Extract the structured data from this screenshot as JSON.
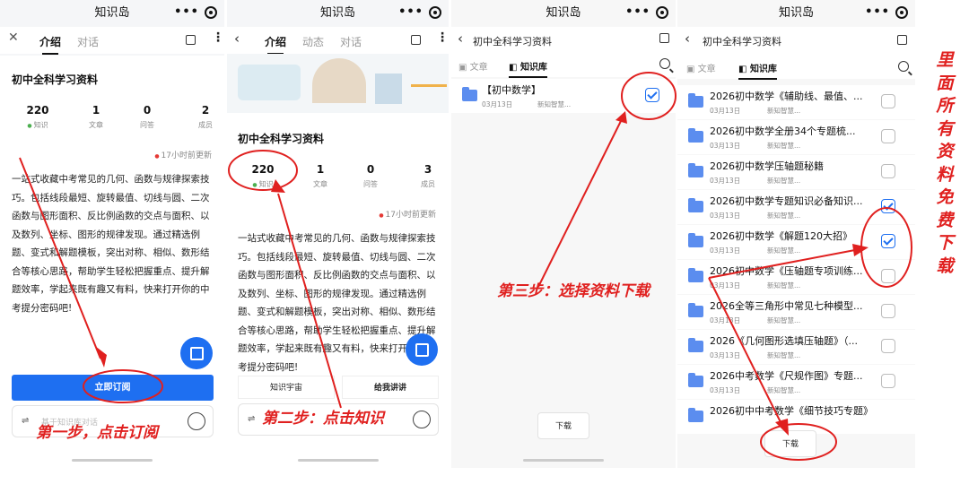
{
  "app_title": "知识岛",
  "knowledge_base_name": "初中全科学习资料",
  "panel1": {
    "tabs": [
      "介绍",
      "对话"
    ],
    "stats": [
      {
        "value": "220",
        "label": "知识"
      },
      {
        "value": "1",
        "label": "文章"
      },
      {
        "value": "0",
        "label": "问答"
      },
      {
        "value": "2",
        "label": "成员"
      }
    ],
    "updated": "17小时前更新",
    "description": "一站式收藏中考常见的几何、函数与规律探索技巧。包括线段最短、旋转最值、切线与圆、二次函数与图形面积、反比例函数的交点与面积、以及数列、坐标、图形的规律发现。通过精选例题、变式和解题模板，突出对称、相似、数形结合等核心思路，帮助学生轻松把握重点、提升解题效率，学起来既有趣又有料，快来打开你的中考提分密码吧!",
    "subscribe_label": "立即订阅",
    "input_placeholder": "基于知识库对话",
    "annotation": "第一步，点击订阅"
  },
  "panel2": {
    "tabs": [
      "介绍",
      "动态",
      "对话"
    ],
    "stats": [
      {
        "value": "220",
        "label": "知识"
      },
      {
        "value": "1",
        "label": "文章"
      },
      {
        "value": "0",
        "label": "问答"
      },
      {
        "value": "3",
        "label": "成员"
      }
    ],
    "updated": "17小时前更新",
    "button_universe": "知识宇宙",
    "button_lecture": "给我讲讲",
    "annotation": "第二步：点击知识"
  },
  "panel3": {
    "header_title": "初中全科学习资料",
    "tabs": [
      "文章",
      "知识库"
    ],
    "folder": {
      "name": "【初中数学】",
      "date": "03月13日",
      "author": "新知智慧..."
    },
    "download_label": "下载",
    "annotation": "第三步：选择资料下载"
  },
  "panel4": {
    "header_title": "初中全科学习资料",
    "tabs": [
      "文章",
      "知识库"
    ],
    "items": [
      {
        "title": "2026初中数学《辅助线、最值、...",
        "date": "03月13日",
        "author": "新知智慧...",
        "checked": false
      },
      {
        "title": "2026初中数学全册34个专题梳...",
        "date": "03月13日",
        "author": "新知智慧...",
        "checked": false
      },
      {
        "title": "2026初中数学压轴题秘籍",
        "date": "03月13日",
        "author": "新知智慧...",
        "checked": false
      },
      {
        "title": "2026初中数学专题知识必备知识...",
        "date": "03月13日",
        "author": "新知智慧...",
        "checked": true
      },
      {
        "title": "2026初中数学《解题120大招》",
        "date": "03月13日",
        "author": "新知智慧...",
        "checked": true
      },
      {
        "title": "2026初中数学《压轴题专项训练...",
        "date": "03月13日",
        "author": "新知智慧...",
        "checked": false
      },
      {
        "title": "2026全等三角形中常见七种模型...",
        "date": "03月13日",
        "author": "新知智慧...",
        "checked": false
      },
      {
        "title": "2026《几何图形选填压轴题》（...",
        "date": "03月13日",
        "author": "新知智慧...",
        "checked": false
      },
      {
        "title": "2026中考数学《尺规作图》专题...",
        "date": "03月13日",
        "author": "新知智慧...",
        "checked": false
      },
      {
        "title": "2026初中中考数学《细节技巧专题》 d",
        "date": "",
        "author": "",
        "checked": false
      }
    ],
    "download_label": "下载"
  },
  "side_annotation": "里面所有资料免费下载",
  "colors": {
    "accent": "#1e6ff1",
    "annotation": "#e0201f"
  }
}
